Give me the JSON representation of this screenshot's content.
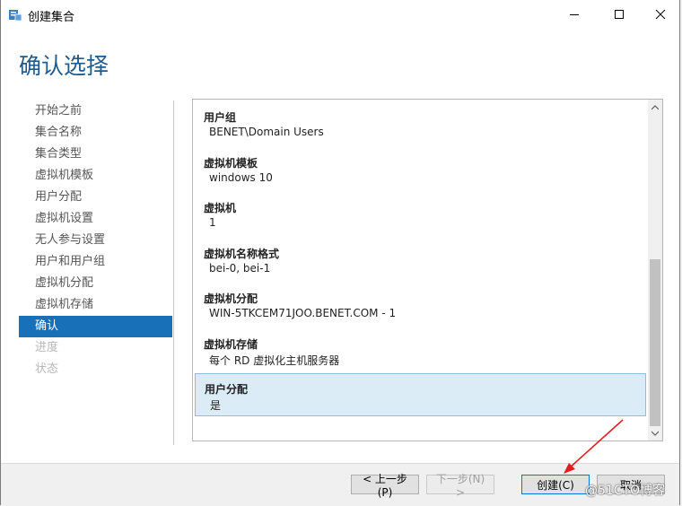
{
  "window": {
    "title": "创建集合"
  },
  "heading": "确认选择",
  "nav": [
    {
      "label": "开始之前",
      "state": "normal"
    },
    {
      "label": "集合名称",
      "state": "normal"
    },
    {
      "label": "集合类型",
      "state": "normal"
    },
    {
      "label": "虚拟机模板",
      "state": "normal"
    },
    {
      "label": "用户分配",
      "state": "normal"
    },
    {
      "label": "虚拟机设置",
      "state": "normal"
    },
    {
      "label": "无人参与设置",
      "state": "normal"
    },
    {
      "label": "用户和用户组",
      "state": "normal"
    },
    {
      "label": "虚拟机分配",
      "state": "normal"
    },
    {
      "label": "虚拟机存储",
      "state": "normal"
    },
    {
      "label": "确认",
      "state": "active"
    },
    {
      "label": "进度",
      "state": "disabled"
    },
    {
      "label": "状态",
      "state": "disabled"
    }
  ],
  "summary": [
    {
      "label": "用户组",
      "value": "BENET\\Domain Users"
    },
    {
      "label": "虚拟机模板",
      "value": "windows 10"
    },
    {
      "label": "虚拟机",
      "value": "1"
    },
    {
      "label": "虚拟机名称格式",
      "value": "bei-0, bei-1"
    },
    {
      "label": "虚拟机分配",
      "value": "WIN-5TKCEM71JOO.BENET.COM - 1"
    },
    {
      "label": "虚拟机存储",
      "value": "每个 RD 虚拟化主机服务器"
    },
    {
      "label": "用户分配",
      "value": "是",
      "selected": true
    }
  ],
  "buttons": {
    "previous": "< 上一步(P)",
    "next": "下一步(N) >",
    "create": "创建(C)",
    "cancel": "取消"
  },
  "watermark": "@51CTO博客",
  "colors": {
    "accent": "#1870b8",
    "heading": "#1e5b8c",
    "annotation_arrow": "#e02020"
  }
}
